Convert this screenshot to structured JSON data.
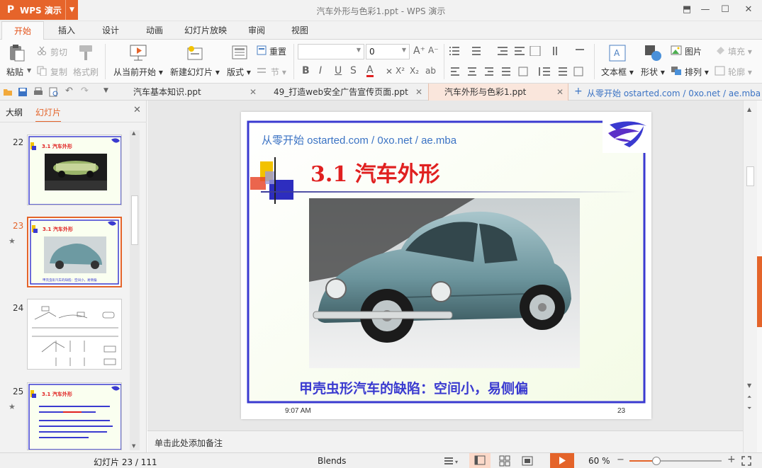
{
  "app": {
    "brand": "WPS 演示",
    "window_title": "汽车外形与色彩1.ppt - WPS 演示"
  },
  "ribbon_tabs": [
    "开始",
    "插入",
    "设计",
    "动画",
    "幻灯片放映",
    "审阅",
    "视图"
  ],
  "toolbar": {
    "paste": "粘贴",
    "cut": "剪切",
    "copy": "复制",
    "format_painter": "格式刷",
    "from_current": "从当前开始",
    "new_slide": "新建幻灯片",
    "layout": "版式",
    "reset": "重置",
    "section": "节",
    "font_size_value": "0",
    "textbox": "文本框",
    "shapes": "形状",
    "picture": "图片",
    "arrange": "排列",
    "fill": "填充",
    "outline": "轮廓"
  },
  "doc_tabs": [
    "汽车基本知识.ppt",
    "49_打造web安全广告宣传页面.ppt",
    "汽车外形与色彩1.ppt"
  ],
  "doc_tab_link": "从零开始 ostarted.com / 0xo.net / ae.mba",
  "left_pane": {
    "tab_outline": "大纲",
    "tab_slides": "幻灯片",
    "slides": [
      {
        "num": "22",
        "title": "3.1 汽车外形"
      },
      {
        "num": "23",
        "title": "3.1 汽车外形",
        "caption": "甲壳虫形汽车的缺陷：空间小，易侧偏"
      },
      {
        "num": "24"
      },
      {
        "num": "25",
        "title": "3.1 汽车外形"
      }
    ]
  },
  "slide": {
    "header_link": "从零开始 ostarted.com / 0xo.net / ae.mba",
    "title": "3.1  汽车外形",
    "caption": "甲壳虫形汽车的缺陷：空间小，易侧偏",
    "time": "9:07 AM",
    "page_number": "23"
  },
  "notes_placeholder": "单击此处添加备注",
  "status": {
    "slide_info": "幻灯片 23 / 111",
    "theme": "Blends",
    "zoom": "60 %"
  },
  "colors": {
    "accent": "#e4642a",
    "slide_blue": "#3a3ad0",
    "title_red": "#e02020"
  }
}
